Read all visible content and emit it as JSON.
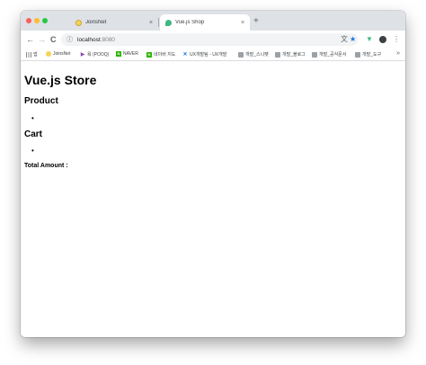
{
  "tabs": [
    {
      "title": "JoinsNet",
      "close": "×"
    },
    {
      "title": "Vue.js Shop",
      "close": "×"
    }
  ],
  "new_tab": "+",
  "toolbar": {
    "back": "←",
    "forward": "→",
    "reload": "C",
    "address_host": "localhost",
    "address_port": ":8080",
    "menu": "⋮"
  },
  "bookmarks": {
    "items": [
      {
        "label": "앱"
      },
      {
        "label": "JoinsNet"
      },
      {
        "label": "욕 (POOQ)"
      },
      {
        "label": "NAVER"
      },
      {
        "label": "네이버 지도"
      },
      {
        "label": "UX개발팀 - UX개발"
      },
      {
        "label": "개발_스니펫"
      },
      {
        "label": "개발_블로그"
      },
      {
        "label": "개발_공식문서"
      },
      {
        "label": "개발_도구"
      }
    ],
    "more": "»"
  },
  "page": {
    "title": "Vue.js Store",
    "product_heading": "Product",
    "cart_heading": "Cart",
    "bullet": "•",
    "total_label": "Total Amount :"
  }
}
